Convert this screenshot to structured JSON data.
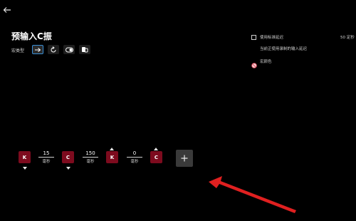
{
  "header": {
    "back_icon": "back-arrow-icon",
    "title": "预输入C振",
    "macro_type_label": "宏类型"
  },
  "mode_buttons": [
    {
      "icon": "arrow-right-icon",
      "active": true
    },
    {
      "icon": "loop-icon",
      "active": false
    },
    {
      "icon": "toggle-icon",
      "active": false
    },
    {
      "icon": "hold-icon",
      "active": false
    }
  ],
  "settings": {
    "use_standard_delay_label": "使用标准延迟",
    "standard_delay_value": "50 定秒",
    "current_recorded_delay_label": "当前正使用录制的输入延迟",
    "macro_color_label": "宏颜色",
    "macro_color_icon": "no-color-icon"
  },
  "sequence": {
    "keys": [
      {
        "label": "K",
        "direction": "down"
      },
      {
        "label": "C",
        "direction": "down"
      },
      {
        "label": "K",
        "direction": "up"
      },
      {
        "label": "C",
        "direction": "up"
      }
    ],
    "delays": [
      {
        "value": "15",
        "unit": "毫秒"
      },
      {
        "value": "150",
        "unit": "毫秒"
      },
      {
        "value": "0",
        "unit": "毫秒"
      }
    ],
    "add_icon": "plus-icon"
  },
  "colors": {
    "background": "#000000",
    "key_tile": "#7d0b1e",
    "accent": "#3a8fd6",
    "annotation_arrow": "#e02020"
  }
}
